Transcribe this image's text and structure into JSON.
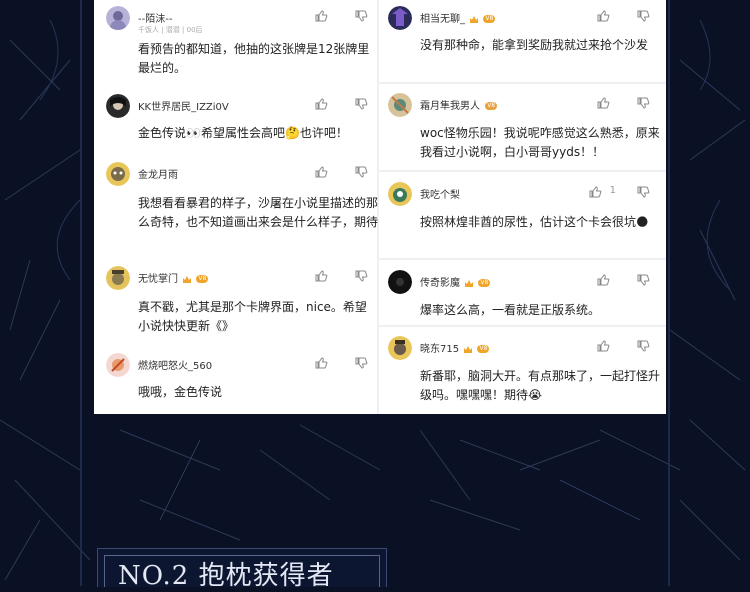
{
  "left_column": [
    {
      "user": "--陌沫--",
      "subline": "千饭人 | 潜潜 | 00后",
      "text": "看预告的都知道，他抽的这张牌是12张牌里最烂的。"
    },
    {
      "user": "KK世界居民_IZZi0V",
      "text": "金色传说👀希望属性会高吧🤔也许吧！"
    },
    {
      "user": "金龙月雨",
      "text": "我想看看暴君的样子，沙屠在小说里描述的那么奇特，也不知道画出来会是什么样子，期待"
    },
    {
      "user": "无忧掌门",
      "badge": "V8",
      "text": "真不戳，尤其是那个卡牌界面，nice。希望小说快快更新《》"
    },
    {
      "user": "燃烧吧怒火_560",
      "text": "哦哦，金色传说"
    }
  ],
  "right_column": [
    {
      "user": "相当无聊_",
      "badge": "V8",
      "text": "没有那种命，能拿到奖励我就过来抢个沙发"
    },
    {
      "user": "霜月隼我男人",
      "badge": "V8",
      "text": "woc怪物乐园！我说呢咋感觉这么熟悉，原来我看过小说啊，白小哥哥yyds！！"
    },
    {
      "user": "我吃个梨",
      "likes": "1",
      "text": "按照林煌非酋的尿性，估计这个卡会很坑🌑"
    },
    {
      "user": "传奇影魔",
      "badge": "V8",
      "text": "爆率这么高，一看就是正版系统。"
    },
    {
      "user": "晓东715",
      "badge": "V8",
      "text": "新番耶，脑洞大开。有点那味了，一起打怪升级吗。嘿嘿嘿！期待😭"
    }
  ],
  "section_title": "NO.2 抱枕获得者",
  "colors": {
    "background": "#0b1124",
    "panel": "#ffffff",
    "badge": "#f0a52a"
  }
}
